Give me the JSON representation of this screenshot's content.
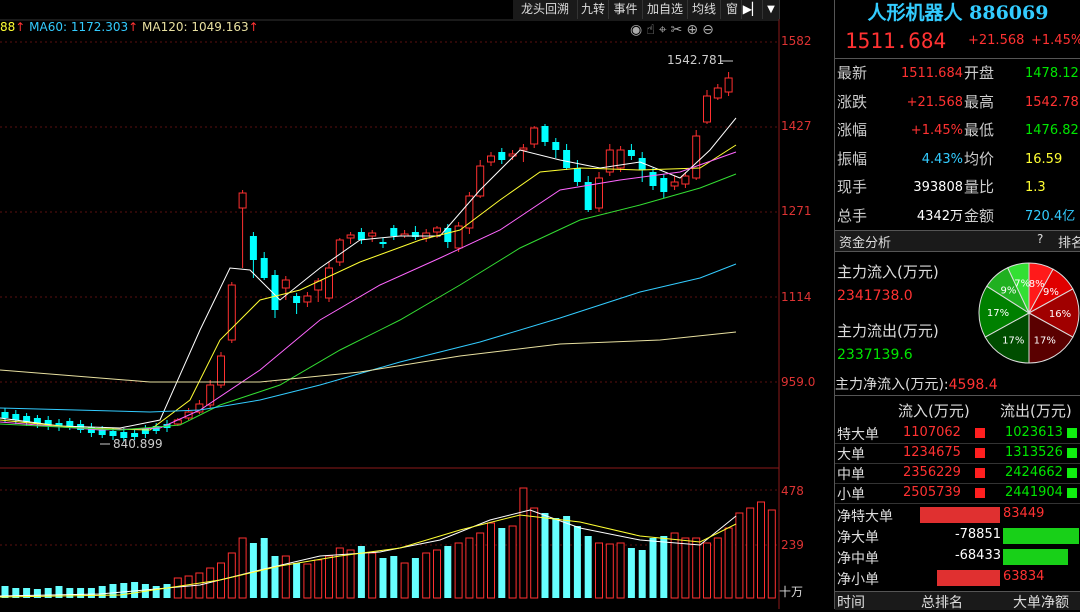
{
  "header_ma": {
    "ma_a": "88",
    "ma60": "MA60: 1172.303",
    "ma120": "MA120: 1049.163"
  },
  "toolbar": [
    "龙头回溯",
    "九转",
    "事件",
    "加自选",
    "均线",
    "窗"
  ],
  "price_axis": [
    "1582",
    "1427",
    "1271",
    "1114",
    "959.0"
  ],
  "volume_axis": [
    "478",
    "239",
    "十万"
  ],
  "annotations": {
    "high": "1542.781",
    "low": "840.899"
  },
  "quote": {
    "name": "人形机器人 886069",
    "price": "1511.684",
    "change": "+21.568",
    "change_pct": "+1.45%",
    "rows": [
      {
        "l1": "最新",
        "v1": "1511.684",
        "l2": "开盘",
        "v2": "1478.12"
      },
      {
        "l1": "涨跌",
        "v1": "+21.568",
        "l2": "最高",
        "v2": "1542.78"
      },
      {
        "l1": "涨幅",
        "v1": "+1.45%",
        "l2": "最低",
        "v2": "1476.82"
      },
      {
        "l1": "振幅",
        "v1": "4.43%",
        "l2": "均价",
        "v2": "16.59"
      },
      {
        "l1": "现手",
        "v1": "393808",
        "l2": "量比",
        "v2": "1.3"
      },
      {
        "l1": "总手",
        "v1": "4342万",
        "l2": "金额",
        "v2": "720.4亿"
      }
    ]
  },
  "fund": {
    "tab": "资金分析",
    "help": "?",
    "rank": "排名",
    "inflow_label": "主力流入(万元)",
    "inflow_value": "2341738.0",
    "outflow_label": "主力流出(万元)",
    "outflow_value": "2337139.6",
    "net_label": "主力净流入(万元):",
    "net_value": "4598.4",
    "pie": [
      {
        "label": "8%",
        "pct": 8,
        "color": "#ff1a1a"
      },
      {
        "label": "9%",
        "pct": 9,
        "color": "#e00000"
      },
      {
        "label": "16%",
        "pct": 16,
        "color": "#a00000"
      },
      {
        "label": "17%",
        "pct": 17,
        "color": "#5a0000"
      },
      {
        "label": "17%",
        "pct": 17,
        "color": "#004d00"
      },
      {
        "label": "17%",
        "pct": 17,
        "color": "#008000"
      },
      {
        "label": "9%",
        "pct": 9,
        "color": "#20b020"
      },
      {
        "label": "7%",
        "pct": 7,
        "color": "#33e033"
      }
    ],
    "col_in": "流入(万元)",
    "col_out": "流出(万元)",
    "flows": [
      {
        "name": "特大单",
        "in": "1107062",
        "out": "1023613"
      },
      {
        "name": "大单",
        "in": "1234675",
        "out": "1313526"
      },
      {
        "name": "中单",
        "in": "2356229",
        "out": "2424662"
      },
      {
        "name": "小单",
        "in": "2505739",
        "out": "2441904"
      }
    ],
    "nets": [
      {
        "name": "净特大单",
        "value": "83449",
        "sign": "pos",
        "frac": 0.38
      },
      {
        "name": "净大单",
        "value": "-78851",
        "sign": "neg",
        "frac": 0.36
      },
      {
        "name": "净中单",
        "value": "-68433",
        "sign": "neg",
        "frac": 0.31
      },
      {
        "name": "净小单",
        "value": "63834",
        "sign": "pos",
        "frac": 0.3
      }
    ],
    "footer": [
      "时间",
      "总排名",
      "大单净额"
    ]
  }
}
